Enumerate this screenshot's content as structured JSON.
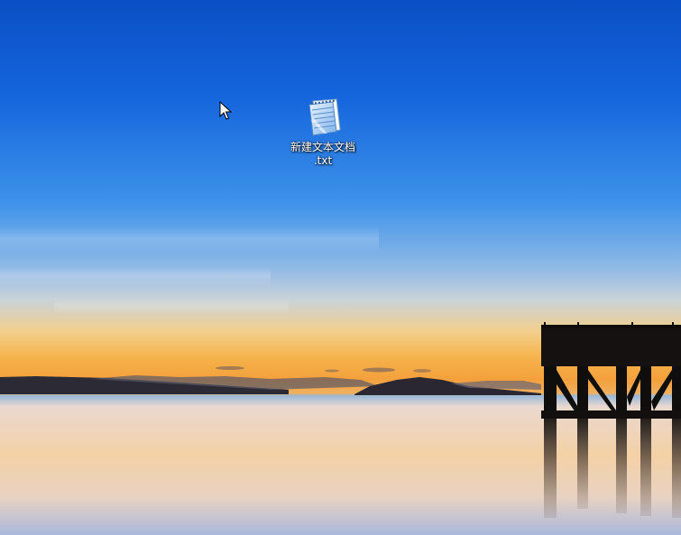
{
  "desktop": {
    "icons": [
      {
        "label_line1": "新建文本文档",
        "label_line2": ".txt",
        "icon": "notepad-icon"
      }
    ]
  },
  "colors": {
    "sky_top": "#0b56c9",
    "sky_mid": "#2f86e6",
    "horizon": "#f4b04a",
    "water": "#f3d7b2"
  }
}
